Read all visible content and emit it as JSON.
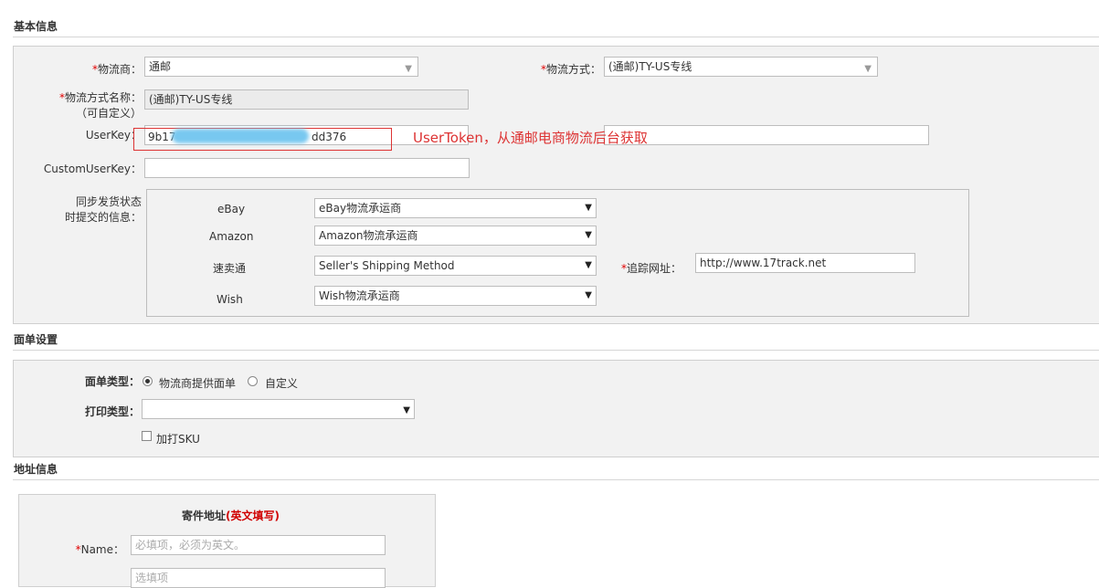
{
  "basic_info": {
    "title": "基本信息",
    "carrier": {
      "required_mark": "*",
      "label": "物流商：",
      "value": "通邮"
    },
    "shipping_method": {
      "required_mark": "*",
      "label": "物流方式：",
      "value": "(通邮)TY-US专线"
    },
    "method_name": {
      "required_mark": "*",
      "label_line1": "物流方式名称：",
      "label_line2": "（可自定义）",
      "value": "(通邮)TY-US专线"
    },
    "userkey": {
      "label": "UserKey：",
      "value_prefix": "9b17",
      "value_suffix": "dd376"
    },
    "annotation": "UserToken，从通邮电商物流后台获取",
    "custom_userkey": {
      "label": "CustomUserKey：",
      "value": ""
    },
    "sync": {
      "label_line1": "同步发货状态",
      "label_line2": "时提交的信息：",
      "rows": [
        {
          "platform": "eBay",
          "value": "eBay物流承运商"
        },
        {
          "platform": "Amazon",
          "value": "Amazon物流承运商"
        },
        {
          "platform": "速卖通",
          "value": "Seller's Shipping Method"
        },
        {
          "platform": "Wish",
          "value": "Wish物流承运商"
        }
      ],
      "tracking": {
        "required_mark": "*",
        "label": "追踪网址：",
        "value": "http://www.17track.net"
      }
    }
  },
  "label_settings": {
    "title": "面单设置",
    "label_type": {
      "label": "面单类型：",
      "options": [
        "物流商提供面单",
        "自定义"
      ],
      "selected": "物流商提供面单"
    },
    "print_type": {
      "label": "打印类型：",
      "value": ""
    },
    "print_sku": {
      "label": "加打SKU",
      "checked": false
    }
  },
  "address_info": {
    "title": "地址信息",
    "sender_title": "寄件地址",
    "sender_note": "(英文填写)",
    "name": {
      "required_mark": "*",
      "label": "Name：",
      "placeholder": "必填项，必须为英文。"
    },
    "second_placeholder": "选填项"
  }
}
